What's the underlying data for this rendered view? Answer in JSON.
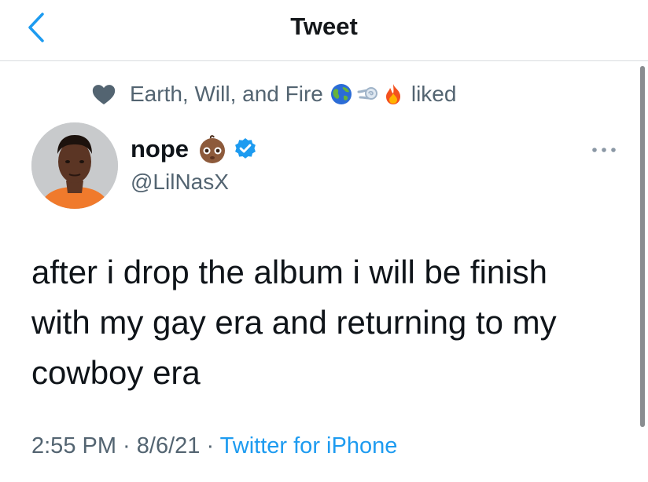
{
  "header": {
    "title": "Tweet",
    "back_icon": "chevron-left-icon"
  },
  "social_context": {
    "icon": "heart-icon",
    "user": "Earth, Will, and Fire",
    "emojis": [
      "globe-icon",
      "dash-icon",
      "fire-icon"
    ],
    "action": "liked"
  },
  "author": {
    "display_name": "nope",
    "handle": "@LilNasX",
    "name_emoji": "baby-face-icon",
    "verified": true
  },
  "tweet": {
    "text": "after i drop the album i will be finish with my gay era and returning to my cowboy era",
    "time": "2:55 PM",
    "date": "8/6/21",
    "separator": " · ",
    "source": "Twitter for iPhone"
  },
  "colors": {
    "accent": "#1d9bf0",
    "secondary_text": "#536471",
    "primary_text": "#0f1419"
  }
}
